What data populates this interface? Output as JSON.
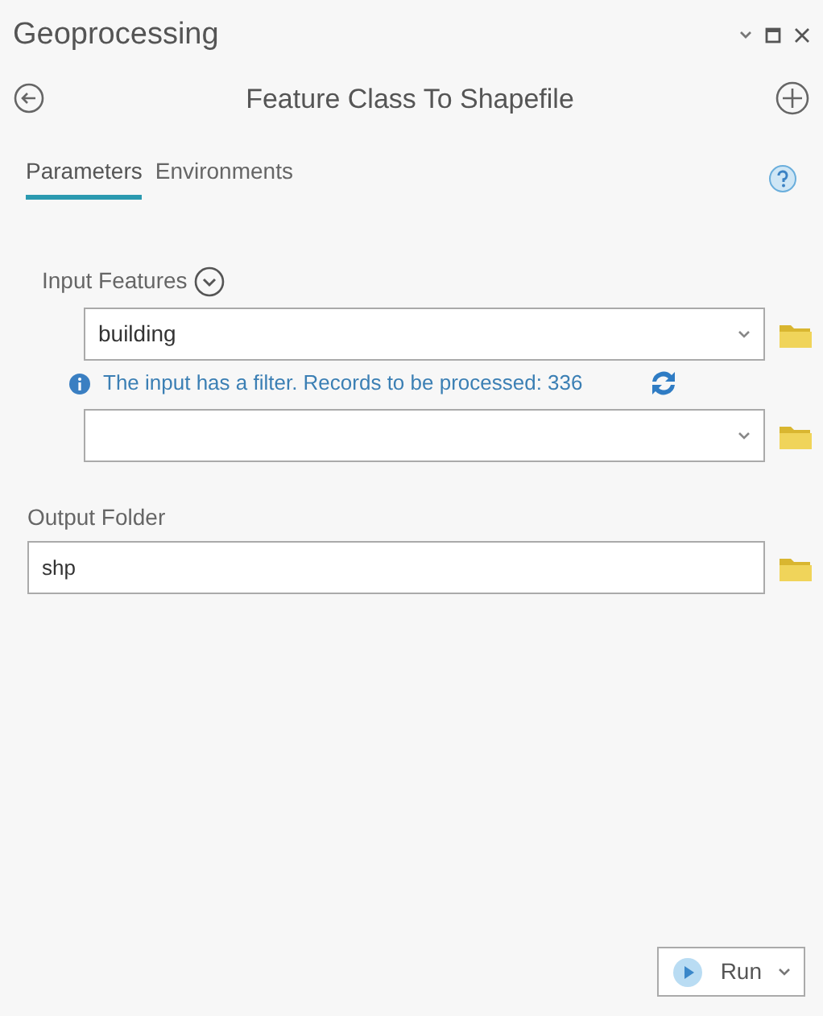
{
  "window": {
    "title": "Geoprocessing"
  },
  "tool": {
    "title": "Feature Class To Shapefile"
  },
  "tabs": [
    {
      "label": "Parameters",
      "selected": true
    },
    {
      "label": "Environments",
      "selected": false
    }
  ],
  "input_features": {
    "label": "Input Features",
    "rows": [
      {
        "value": "building",
        "info": "The input has a filter. Records to be processed: 336"
      },
      {
        "value": ""
      }
    ]
  },
  "output_folder": {
    "label": "Output Folder",
    "value": "shp"
  },
  "run_button": {
    "label": "Run"
  }
}
